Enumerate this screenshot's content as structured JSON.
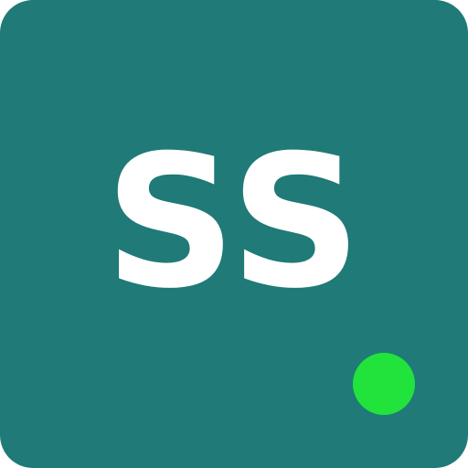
{
  "avatar": {
    "initials": "SS",
    "background_color": "#1f7a78",
    "text_color": "#ffffff"
  },
  "status": {
    "indicator": "online-dot",
    "color": "#22e33b"
  }
}
